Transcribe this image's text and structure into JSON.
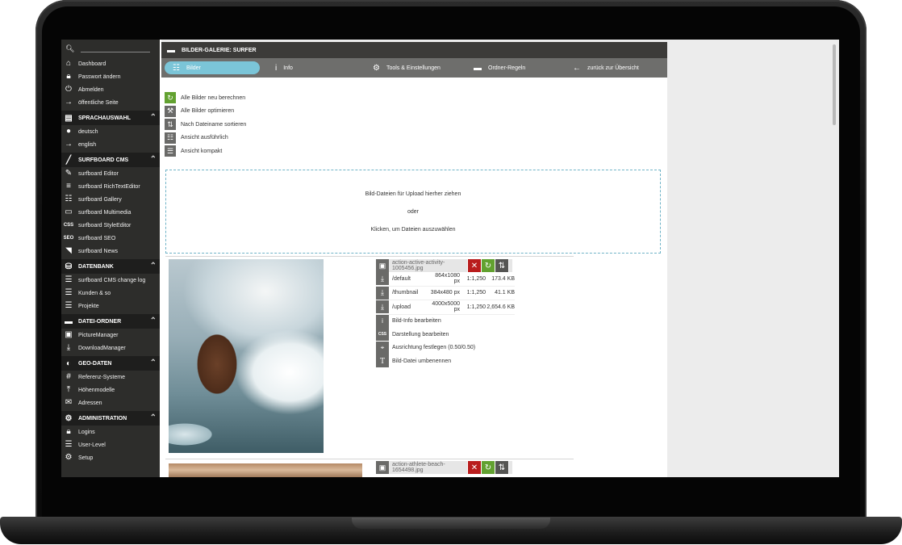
{
  "sidebar": {
    "top_items": [
      {
        "icon": "home-icon",
        "label": "Dashboard"
      },
      {
        "icon": "lock-icon",
        "label": "Passwort ändern"
      },
      {
        "icon": "power-icon",
        "label": "Abmelden"
      },
      {
        "icon": "arrow-right-icon",
        "label": "öffentliche Seite"
      }
    ],
    "sections": [
      {
        "title": "SPRACHAUSWAHL",
        "icon": "chat-icon",
        "items": [
          {
            "icon": "dot-icon",
            "label": "deutsch"
          },
          {
            "icon": "arrow-right-icon",
            "label": "english"
          }
        ]
      },
      {
        "title": "SURFBOARD CMS",
        "icon": "surfboard-icon",
        "items": [
          {
            "icon": "edit-icon",
            "label": "surfboard Editor"
          },
          {
            "icon": "text-icon",
            "label": "surfboard RichTextEditor"
          },
          {
            "icon": "grid-icon",
            "label": "surfboard Gallery"
          },
          {
            "icon": "monitor-icon",
            "label": "surfboard Multimedia"
          },
          {
            "icon": "css-icon",
            "label": "surfboard StyleEditor"
          },
          {
            "icon": "seo-icon",
            "label": "surfboard SEO"
          },
          {
            "icon": "rss-icon",
            "label": "surfboard News"
          }
        ]
      },
      {
        "title": "DATENBANK",
        "icon": "database-icon",
        "items": [
          {
            "icon": "list-icon",
            "label": "surfboard CMS change log"
          },
          {
            "icon": "list-icon",
            "label": "Kunden & so"
          },
          {
            "icon": "list-icon",
            "label": "Projekte"
          }
        ]
      },
      {
        "title": "DATEI-ORDNER",
        "icon": "folder-icon",
        "items": [
          {
            "icon": "camera-icon",
            "label": "PictureManager"
          },
          {
            "icon": "download-icon",
            "label": "DownloadManager"
          }
        ]
      },
      {
        "title": "GEO-DATEN",
        "icon": "globe-icon",
        "items": [
          {
            "icon": "hash-icon",
            "label": "Referenz-Systeme"
          },
          {
            "icon": "upload-icon",
            "label": "Höhenmodelle"
          },
          {
            "icon": "mail-icon",
            "label": "Adressen"
          }
        ]
      },
      {
        "title": "ADMINISTRATION",
        "icon": "gear-icon",
        "items": [
          {
            "icon": "lock-icon",
            "label": "Logins"
          },
          {
            "icon": "list-icon",
            "label": "User-Level"
          },
          {
            "icon": "gear-icon",
            "label": "Setup"
          }
        ]
      }
    ]
  },
  "main": {
    "title": "BILDER-GALERIE: SURFER",
    "tabs": [
      {
        "icon": "grid-icon",
        "label": "Bilder"
      },
      {
        "icon": "info-icon",
        "label": "Info"
      },
      {
        "icon": "gear-icon",
        "label": "Tools & Einstellungen"
      },
      {
        "icon": "folder-icon",
        "label": "Ordner-Regeln"
      },
      {
        "icon": "arrow-left-icon",
        "label": "zurück zur Übersicht"
      }
    ],
    "actions": [
      {
        "icon": "refresh-icon",
        "label": "Alle Bilder neu berechnen"
      },
      {
        "icon": "hammer-icon",
        "label": "Alle Bilder optimieren"
      },
      {
        "icon": "sort-icon",
        "label": "Nach Dateiname sortieren"
      },
      {
        "icon": "grid-icon",
        "label": "Ansicht ausführlich"
      },
      {
        "icon": "list-icon",
        "label": "Ansicht kompakt"
      }
    ],
    "dropzone": {
      "line1": "Bild-Dateien für Upload hierher ziehen",
      "line2": "oder",
      "line3": "Klicken, um Dateien auszuwählen"
    },
    "images": [
      {
        "filename": "action-active-activity-1005456.jpg",
        "versions": [
          {
            "name": "/default",
            "size": "864x1080 px",
            "ratio": "1:1,250",
            "filesize": "173.4 KB"
          },
          {
            "name": "/thumbnail",
            "size": "384x480 px",
            "ratio": "1:1,250",
            "filesize": "41.1 KB"
          },
          {
            "name": "/upload",
            "size": "4000x5000 px",
            "ratio": "1:1,250",
            "filesize": "2,654.6 KB"
          }
        ],
        "options": [
          {
            "icon": "info-icon",
            "label": "Bild-Info bearbeiten"
          },
          {
            "icon": "css-icon",
            "label": "Darstellung bearbeiten"
          },
          {
            "icon": "crosshair-icon",
            "label": "Ausrichtung festlegen (0.50/0.50)"
          },
          {
            "icon": "text-t-icon",
            "label": "Bild-Datei umbenennen"
          }
        ]
      },
      {
        "filename": "action-athlete-beach-1654498.jpg"
      }
    ]
  }
}
